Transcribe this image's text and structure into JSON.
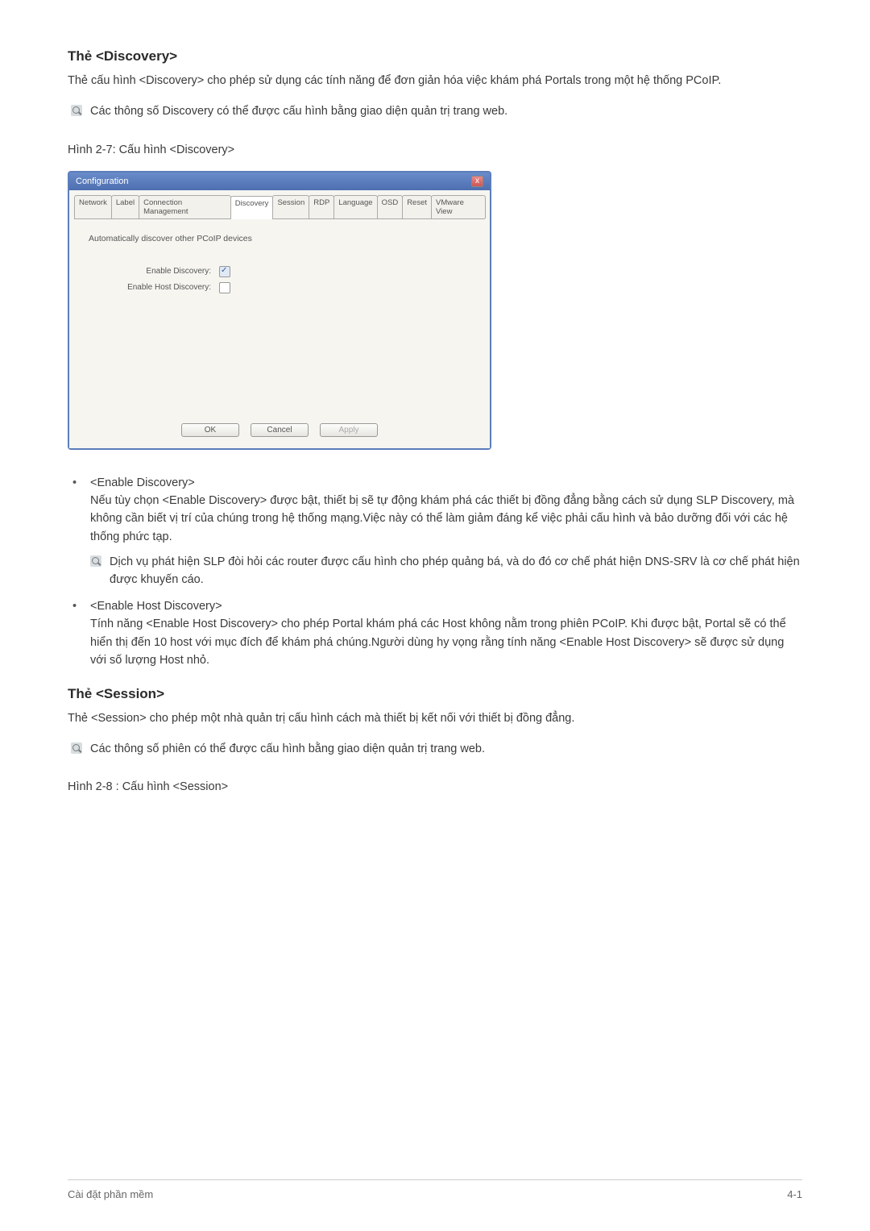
{
  "doc": {
    "heading1": "Thẻ <Discovery>",
    "para1": "Thẻ cấu hình <Discovery> cho phép sử dụng các tính năng để đơn giản hóa việc khám phá Portals trong một hệ thống PCoIP.",
    "note1": "Các thông số Discovery có thể được cấu hình bằng giao diện quản trị trang web.",
    "caption1": "Hình 2-7: Cấu hình <Discovery>",
    "heading2": "Thẻ <Session>",
    "para2": "Thẻ <Session> cho phép một nhà quản trị cấu hình cách mà thiết bị kết nối với thiết bị đồng đẳng.",
    "note2": "Các thông số phiên có thể được cấu hình bằng giao diện quản trị trang web.",
    "caption2": "Hình  2-8 : Cấu hình <Session>"
  },
  "dialog": {
    "title": "Configuration",
    "close": "x",
    "tabs": [
      "Network",
      "Label",
      "Connection Management",
      "Discovery",
      "Session",
      "RDP",
      "Language",
      "OSD",
      "Reset",
      "VMware View"
    ],
    "activeTab": "Discovery",
    "instruction": "Automatically discover other PCoIP devices",
    "field1_label": "Enable Discovery:",
    "field2_label": "Enable Host Discovery:",
    "btn_ok": "OK",
    "btn_cancel": "Cancel",
    "btn_apply": "Apply"
  },
  "bullets": {
    "item1_head": "<Enable Discovery>",
    "item1_body": "Nếu tùy chọn <Enable Discovery> được bật, thiết bị sẽ tự động khám phá các thiết bị đồng đẳng bằng cách sử dụng SLP Discovery, mà không cần biết vị trí của chúng trong hệ thống mạng.Việc này có thể làm giảm đáng kể việc phải cấu hình và bảo dưỡng đối với các hệ thống phức tạp.",
    "item1_note": "Dịch vụ phát hiện SLP đòi hỏi các router được cấu hình cho phép quảng bá, và do đó cơ chế phát hiện DNS-SRV là cơ chế phát hiện được khuyến cáo.",
    "item2_head": "<Enable Host Discovery>",
    "item2_body": "Tính năng <Enable Host Discovery> cho phép Portal khám phá các Host không nằm trong phiên PCoIP. Khi được bật, Portal sẽ có thể hiển thị đến 10 host với mục đích để khám phá chúng.Người dùng hy vọng rằng tính năng <Enable Host Discovery> sẽ được sử dụng với số lượng Host nhỏ."
  },
  "footer": {
    "left": "Cài đặt phần mềm",
    "right": "4-1"
  }
}
